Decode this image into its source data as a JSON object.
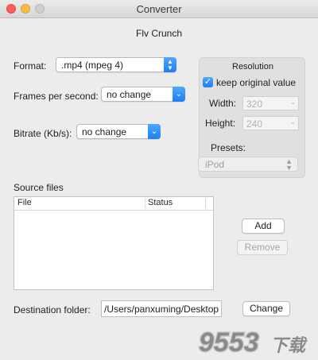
{
  "window": {
    "title": "Converter"
  },
  "app": {
    "heading": "Flv Crunch"
  },
  "format": {
    "label": "Format:",
    "value": ".mp4 (mpeg 4)"
  },
  "fps": {
    "label": "Frames per second:",
    "value": "no change"
  },
  "bitrate": {
    "label": "Bitrate (Kb/s):",
    "value": "no change"
  },
  "resolution": {
    "title": "Resolution",
    "keep_label": "keep original value",
    "keep_checked": true,
    "width_label": "Width:",
    "width_value": "320",
    "height_label": "Height:",
    "height_value": "240",
    "presets_label": "Presets:",
    "preset_value": "iPod"
  },
  "source": {
    "label": "Source files",
    "columns": [
      "File",
      "Status"
    ],
    "rows": []
  },
  "buttons": {
    "add": "Add",
    "remove": "Remove",
    "change": "Change"
  },
  "destination": {
    "label": "Destination folder:",
    "path": "/Users/panxuming/Desktop"
  },
  "watermark": {
    "text": "9553",
    "suffix": "下载"
  },
  "colors": {
    "accent": "#1f7ef3",
    "close": "#fc605c",
    "minimize": "#fdbc40"
  }
}
